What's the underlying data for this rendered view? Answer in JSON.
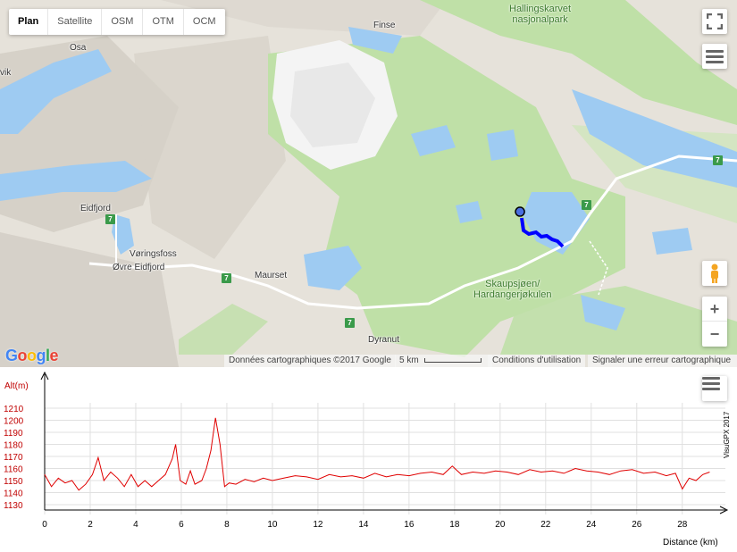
{
  "map": {
    "types": [
      "Plan",
      "Satellite",
      "OSM",
      "OTM",
      "OCM"
    ],
    "active_type": "Plan",
    "labels": {
      "osa": "Osa",
      "vik": "vik",
      "finse": "Finse",
      "eidfjord": "Eidfjord",
      "voringsfoss": "Vøringsfoss",
      "ovre_eidfjord": "Øvre Eidfjord",
      "maurset": "Maurset",
      "dyranut": "Dyranut"
    },
    "park_top": "Hallingskarvet\nnasjonalpark",
    "park_bottom": "Skaupsjøen/\nHardangerjøkulen",
    "road_number": "7",
    "zoom_in": "+",
    "zoom_out": "−",
    "google_letters": [
      "G",
      "o",
      "o",
      "g",
      "l",
      "e"
    ],
    "google_colors": [
      "#4285F4",
      "#EA4335",
      "#FBBC05",
      "#4285F4",
      "#34A853",
      "#EA4335"
    ],
    "attribution": "Données cartographiques ©2017 Google",
    "scale": "5 km",
    "terms": "Conditions d'utilisation",
    "report": "Signaler une erreur cartographique",
    "colors": {
      "water": "#9ecbf2",
      "park": "#bfe0a7",
      "terrain": "#e6e2da",
      "track": "#0000ff"
    }
  },
  "profile": {
    "y_axis_label": "Alt(m)",
    "x_axis_label": "Distance (km)",
    "credit": "VisuGPX 2017",
    "y_ticks": [
      1130,
      1140,
      1150,
      1160,
      1170,
      1180,
      1190,
      1200,
      1210
    ],
    "x_ticks": [
      0,
      2,
      4,
      6,
      8,
      10,
      12,
      14,
      16,
      18,
      20,
      22,
      24,
      26,
      28
    ],
    "line_color": "#e00000"
  },
  "chart_data": {
    "type": "line",
    "title": "",
    "xlabel": "Distance (km)",
    "ylabel": "Alt(m)",
    "xlim": [
      0,
      29.5
    ],
    "ylim": [
      1130,
      1210
    ],
    "grid": true,
    "series": [
      {
        "x": [
          0,
          0.3,
          0.6,
          0.9,
          1.2,
          1.5,
          1.8,
          2.1,
          2.35,
          2.6,
          2.9,
          3.2,
          3.5,
          3.8,
          4.1,
          4.4,
          4.7,
          5.0,
          5.3,
          5.6,
          5.75,
          5.95,
          6.2,
          6.4,
          6.6,
          6.9,
          7.1,
          7.3,
          7.5,
          7.7,
          7.9,
          8.1,
          8.4,
          8.8,
          9.2,
          9.6,
          10.0,
          10.5,
          11.0,
          11.5,
          12.0,
          12.5,
          13.0,
          13.5,
          14.0,
          14.5,
          15.0,
          15.5,
          16.0,
          16.5,
          17.0,
          17.5,
          17.9,
          18.3,
          18.8,
          19.3,
          19.8,
          20.3,
          20.8,
          21.3,
          21.8,
          22.3,
          22.8,
          23.3,
          23.8,
          24.3,
          24.8,
          25.3,
          25.8,
          26.3,
          26.8,
          27.3,
          27.7,
          28.0,
          28.3,
          28.6,
          28.9,
          29.2
        ],
        "y": [
          1155,
          1145,
          1152,
          1148,
          1150,
          1142,
          1147,
          1155,
          1169,
          1150,
          1157,
          1152,
          1145,
          1155,
          1145,
          1150,
          1145,
          1150,
          1155,
          1168,
          1180,
          1150,
          1147,
          1158,
          1147,
          1150,
          1160,
          1175,
          1202,
          1180,
          1145,
          1148,
          1147,
          1151,
          1149,
          1152,
          1150,
          1152,
          1154,
          1153,
          1151,
          1155,
          1153,
          1154,
          1152,
          1156,
          1153,
          1155,
          1154,
          1156,
          1157,
          1155,
          1162,
          1155,
          1157,
          1156,
          1158,
          1157,
          1155,
          1159,
          1157,
          1158,
          1156,
          1160,
          1158,
          1157,
          1155,
          1158,
          1159,
          1156,
          1157,
          1154,
          1156,
          1143,
          1152,
          1150,
          1155,
          1157
        ]
      }
    ]
  }
}
